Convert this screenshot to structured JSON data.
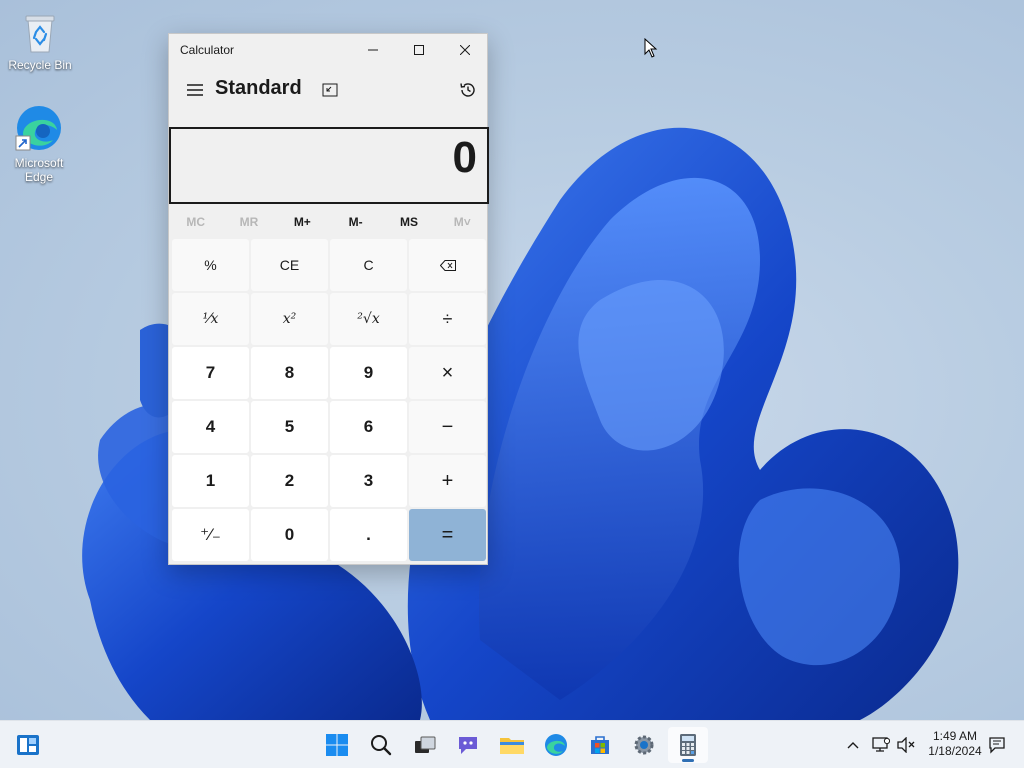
{
  "desktop": {
    "icons": [
      {
        "label": "Recycle Bin"
      },
      {
        "label": "Microsoft Edge"
      }
    ]
  },
  "calculator": {
    "window_title": "Calculator",
    "mode": "Standard",
    "display_value": "0",
    "memory_buttons": [
      {
        "label": "MC",
        "enabled": false
      },
      {
        "label": "MR",
        "enabled": false
      },
      {
        "label": "M+",
        "enabled": true
      },
      {
        "label": "M-",
        "enabled": true
      },
      {
        "label": "MS",
        "enabled": true
      },
      {
        "label": "M˅",
        "enabled": false
      }
    ],
    "keys": {
      "percent": "%",
      "ce": "CE",
      "c": "C",
      "reciprocal": "¹⁄x",
      "square": "x²",
      "sqrt": "²√x",
      "divide": "÷",
      "seven": "7",
      "eight": "8",
      "nine": "9",
      "multiply": "×",
      "four": "4",
      "five": "5",
      "six": "6",
      "minus": "−",
      "one": "1",
      "two": "2",
      "three": "3",
      "plus": "+",
      "negate": "⁺⁄₋",
      "zero": "0",
      "decimal": ".",
      "equals": "="
    },
    "accent_equals": "#8fb3d6"
  },
  "taskbar": {
    "clock": {
      "time": "1:49 AM",
      "date": "1/18/2024"
    }
  }
}
